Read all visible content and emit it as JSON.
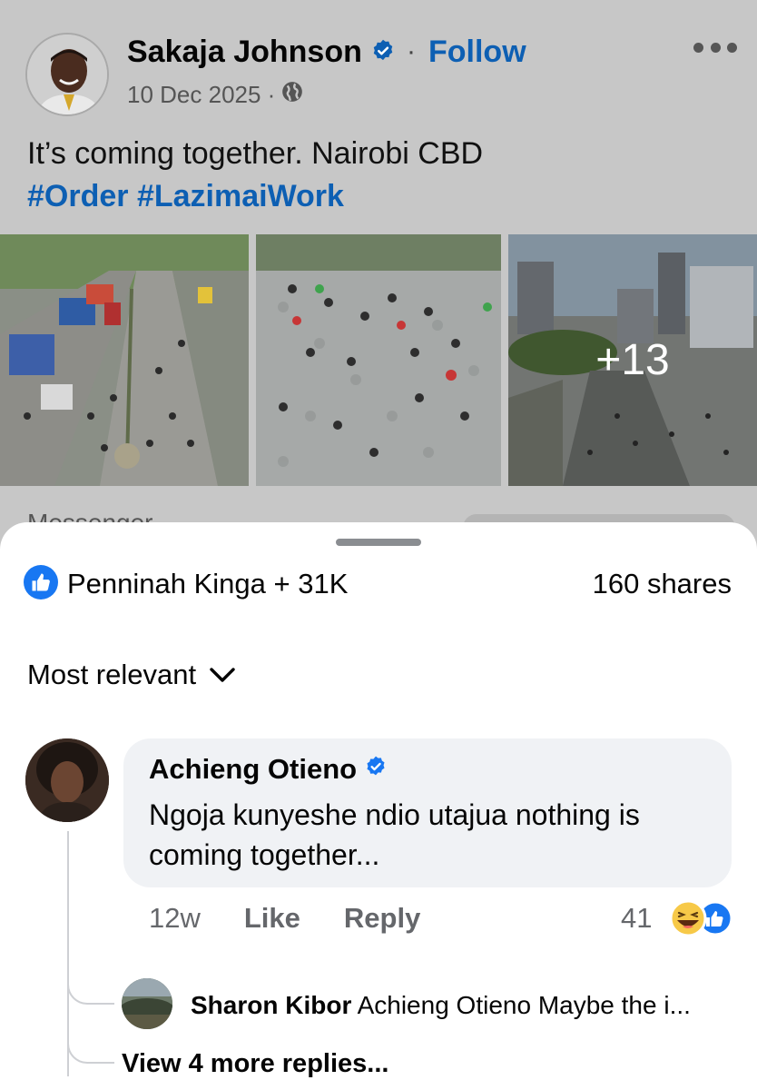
{
  "post": {
    "author": "Sakaja Johnson",
    "follow_label": "Follow",
    "date": "10 Dec 2025 ·",
    "text": "It’s coming together. Nairobi CBD",
    "hashtags": "#Order #LazimaiWork",
    "extra_photos": "+13",
    "messenger_peek": "Messenger",
    "icons": {
      "verified": "verified-badge-icon",
      "audience": "globe-icon",
      "more": "more-options-icon"
    }
  },
  "sheet": {
    "reactions_label": "Penninah Kinga + 31K",
    "shares_label": "160 shares",
    "sort_label": "Most relevant",
    "icons": {
      "like": "like-reaction-icon",
      "sort": "chevron-down-icon"
    }
  },
  "comment": {
    "author": "Achieng Otieno",
    "text": "Ngoja kunyeshe ndio utajua nothing is coming together...",
    "time": "12w",
    "like_label": "Like",
    "reply_label": "Reply",
    "reaction_count": "41",
    "icons": {
      "reactions": [
        "haha-reaction-icon",
        "like-reaction-icon"
      ]
    }
  },
  "reply": {
    "author": "Sharon Kibor",
    "text": "Achieng Otieno Maybe the i...",
    "view_more_label": "View 4 more replies..."
  },
  "colors": {
    "link_blue": "#0d5fb3",
    "facebook_blue": "#1877f2",
    "secondary_text": "#65676b",
    "bubble_bg": "#f0f2f5",
    "dim_bg": "#c7c7c7"
  }
}
